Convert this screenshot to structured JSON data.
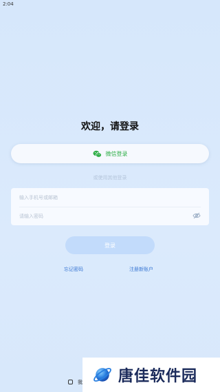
{
  "status_bar": {
    "time": "2:04"
  },
  "title": "欢迎，请登录",
  "wechat_login": {
    "label": "微信登录",
    "icon": "wechat-icon",
    "color": "#2fae47"
  },
  "alt_login_text": "或使用其他登录",
  "form": {
    "account_placeholder": "输入手机号或邮箱",
    "password_placeholder": "请输入密码",
    "password_toggle_icon": "eye-off-icon"
  },
  "login_button": {
    "label": "登录"
  },
  "links": {
    "forgot": "忘记密码",
    "register": "注册新账户"
  },
  "agreement": {
    "text": "我"
  },
  "watermark": {
    "text": "唐佳软件园",
    "logo": "planet-logo"
  },
  "colors": {
    "accent": "#3a78d4",
    "button_disabled": "#c2dbfb",
    "background": "#d6e7fb"
  }
}
